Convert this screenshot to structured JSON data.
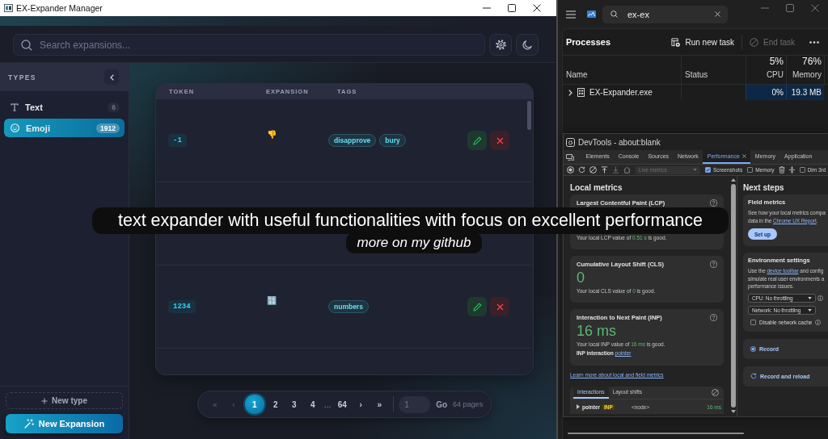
{
  "app": {
    "title": "EX-Expander Manager",
    "search": {
      "placeholder": "Search expansions..."
    },
    "sidebar": {
      "heading": "TYPES",
      "items": [
        {
          "kind": "text",
          "label": "Text",
          "count": "6",
          "selected": false
        },
        {
          "kind": "emoji",
          "label": "Emoji",
          "count": "1912",
          "selected": true
        }
      ],
      "new_type": "New type",
      "new_expansion": "New Expansion"
    },
    "table": {
      "columns": [
        "TOKEN",
        "EXPANSION",
        "TAGS"
      ],
      "rows": [
        {
          "kind": "entry",
          "token": "-1",
          "expansion": "👎",
          "tags": [
            "disapprove",
            "bury"
          ]
        },
        {
          "kind": "covered"
        },
        {
          "kind": "entry",
          "token": "1234",
          "expansion": "🔢",
          "tags": [
            "numbers"
          ]
        }
      ]
    },
    "pagination": {
      "nav_start": [
        {
          "label": "«",
          "disabled": true
        },
        {
          "label": "‹",
          "disabled": true
        }
      ],
      "pages": [
        {
          "kind": "page",
          "label": "1",
          "selected": true
        },
        {
          "kind": "page",
          "label": "2",
          "selected": false
        },
        {
          "kind": "page",
          "label": "3",
          "selected": false
        },
        {
          "kind": "page",
          "label": "4",
          "selected": false
        },
        {
          "kind": "gap",
          "label": "..."
        },
        {
          "kind": "page",
          "label": "64",
          "selected": false
        }
      ],
      "nav_end": [
        {
          "label": "›",
          "disabled": false
        },
        {
          "label": "»",
          "disabled": false
        }
      ],
      "jump_placeholder": "1",
      "go": "Go",
      "total": "64 pages"
    }
  },
  "task_manager": {
    "search": {
      "value": "ex-ex"
    },
    "heading": "Processes",
    "actions": [
      {
        "kind": "run",
        "label": "Run new task",
        "disabled": false
      },
      {
        "kind": "end",
        "label": "End task",
        "disabled": true
      }
    ],
    "columns": [
      {
        "label": "Name"
      },
      {
        "label": "Status"
      },
      {
        "label": "CPU",
        "usage": "5%"
      },
      {
        "label": "Memory",
        "usage": "76%"
      }
    ],
    "processes": [
      {
        "name": "EX-Expander.exe",
        "expanded": false,
        "cpu": "0%",
        "memory": "19.3 MB"
      }
    ]
  },
  "devtools": {
    "title": "DevTools - about:blank",
    "tabs": [
      {
        "label": "Elements",
        "selected": false
      },
      {
        "label": "Console",
        "selected": false
      },
      {
        "label": "Sources",
        "selected": false
      },
      {
        "label": "Network",
        "selected": false
      },
      {
        "label": "Performance",
        "selected": true
      },
      {
        "label": "Memory",
        "selected": false
      },
      {
        "label": "Application",
        "selected": false
      }
    ],
    "toolbar": {
      "mode": {
        "label": "Live metrics",
        "disabled": true
      },
      "options": [
        {
          "label": "Screenshots",
          "checked": true
        },
        {
          "label": "Memory",
          "checked": false
        },
        {
          "label": "Dim 3rd",
          "checked": false
        }
      ]
    },
    "local_metrics": {
      "heading": "Local metrics",
      "cards": [
        {
          "title": "Largest Contentful Paint (LCP)",
          "note_lead": "Your local LCP value of",
          "note_value": "0.51 s",
          "note_tail": "is good."
        },
        {
          "title": "Cumulative Layout Shift (CLS)",
          "value": "0",
          "note_lead": "Your local CLS value of",
          "note_value": "0",
          "note_tail": "is good."
        },
        {
          "title": "Interaction to Next Paint (INP)",
          "value": "16 ms",
          "note_lead": "Your local INP value of",
          "note_value": "16 ms",
          "note_tail": "is good.",
          "detail_label": "INP interaction",
          "detail_link": "pointer"
        }
      ],
      "learn_more": "Learn more about local and field metrics",
      "interactions": {
        "tabs": [
          {
            "label": "Interactions",
            "selected": true
          },
          {
            "label": "Layout shifts",
            "selected": false
          }
        ],
        "rows": [
          {
            "event": "pointer",
            "badge": "INP",
            "target": "<node>",
            "duration": "16 ms",
            "expanded": false
          }
        ]
      }
    },
    "next_steps": {
      "heading": "Next steps",
      "field_metrics": {
        "title": "Field metrics",
        "lines": [
          {
            "text": "See how your local metrics compa"
          },
          {
            "text": "data in the",
            "link": "Chrome UX Report",
            "tail": "."
          }
        ],
        "button": "Set up"
      },
      "environment": {
        "title": "Environment settings",
        "lines": [
          {
            "text": "Use the",
            "link": "device toolbar",
            "tail": " and config"
          },
          {
            "text": "simulate real user environments a"
          },
          {
            "text": "performance issues."
          }
        ],
        "selects": [
          "CPU: No throttling",
          "Network: No throttling"
        ],
        "cache": {
          "label": "Disable network cache",
          "checked": false
        }
      },
      "record": {
        "label": "Record",
        "selected": true
      },
      "record_reload": {
        "label": "Record and reload"
      }
    }
  },
  "caption": {
    "line": "text expander with useful functionalities with focus on excellent performance",
    "subline": "more on my github"
  }
}
